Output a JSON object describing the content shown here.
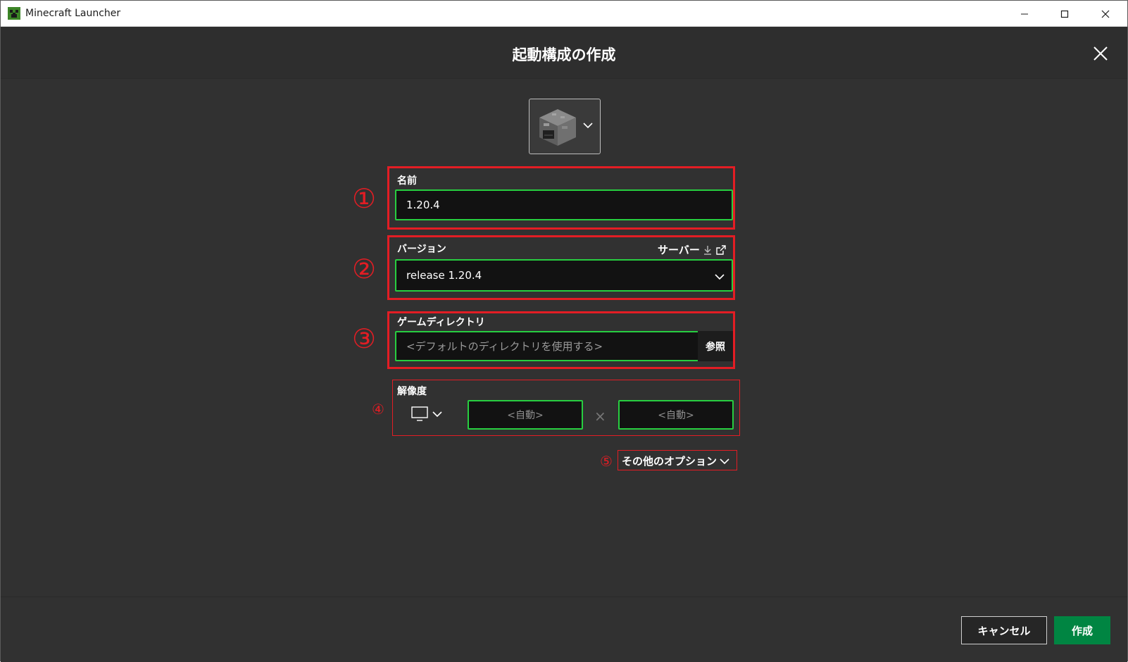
{
  "window": {
    "title": "Minecraft Launcher"
  },
  "dialog": {
    "title": "起動構成の作成"
  },
  "form": {
    "name": {
      "label": "名前",
      "value": "1.20.4"
    },
    "version": {
      "label": "バージョン",
      "server_link": "サーバー",
      "value": "release 1.20.4"
    },
    "game_dir": {
      "label": "ゲームディレクトリ",
      "placeholder": "<デフォルトのディレクトリを使用する>",
      "browse_label": "参照"
    },
    "resolution": {
      "label": "解像度",
      "width": "<自動>",
      "height": "<自動>",
      "separator": "×"
    },
    "more_options": "その他のオプション"
  },
  "annotations": {
    "n1": "①",
    "n2": "②",
    "n3": "③",
    "n4": "④",
    "n5": "⑤"
  },
  "footer": {
    "cancel_label": "キャンセル",
    "create_label": "作成"
  },
  "colors": {
    "background": "#313131",
    "field_border": "#27ce40",
    "annotation": "#e31d24",
    "primary_button": "#008542"
  },
  "icons": [
    "minecraft-creeper-icon",
    "minimize-icon",
    "maximize-icon",
    "close-icon",
    "furnace-icon",
    "chevron-down-icon",
    "download-icon",
    "external-link-icon",
    "monitor-icon"
  ]
}
